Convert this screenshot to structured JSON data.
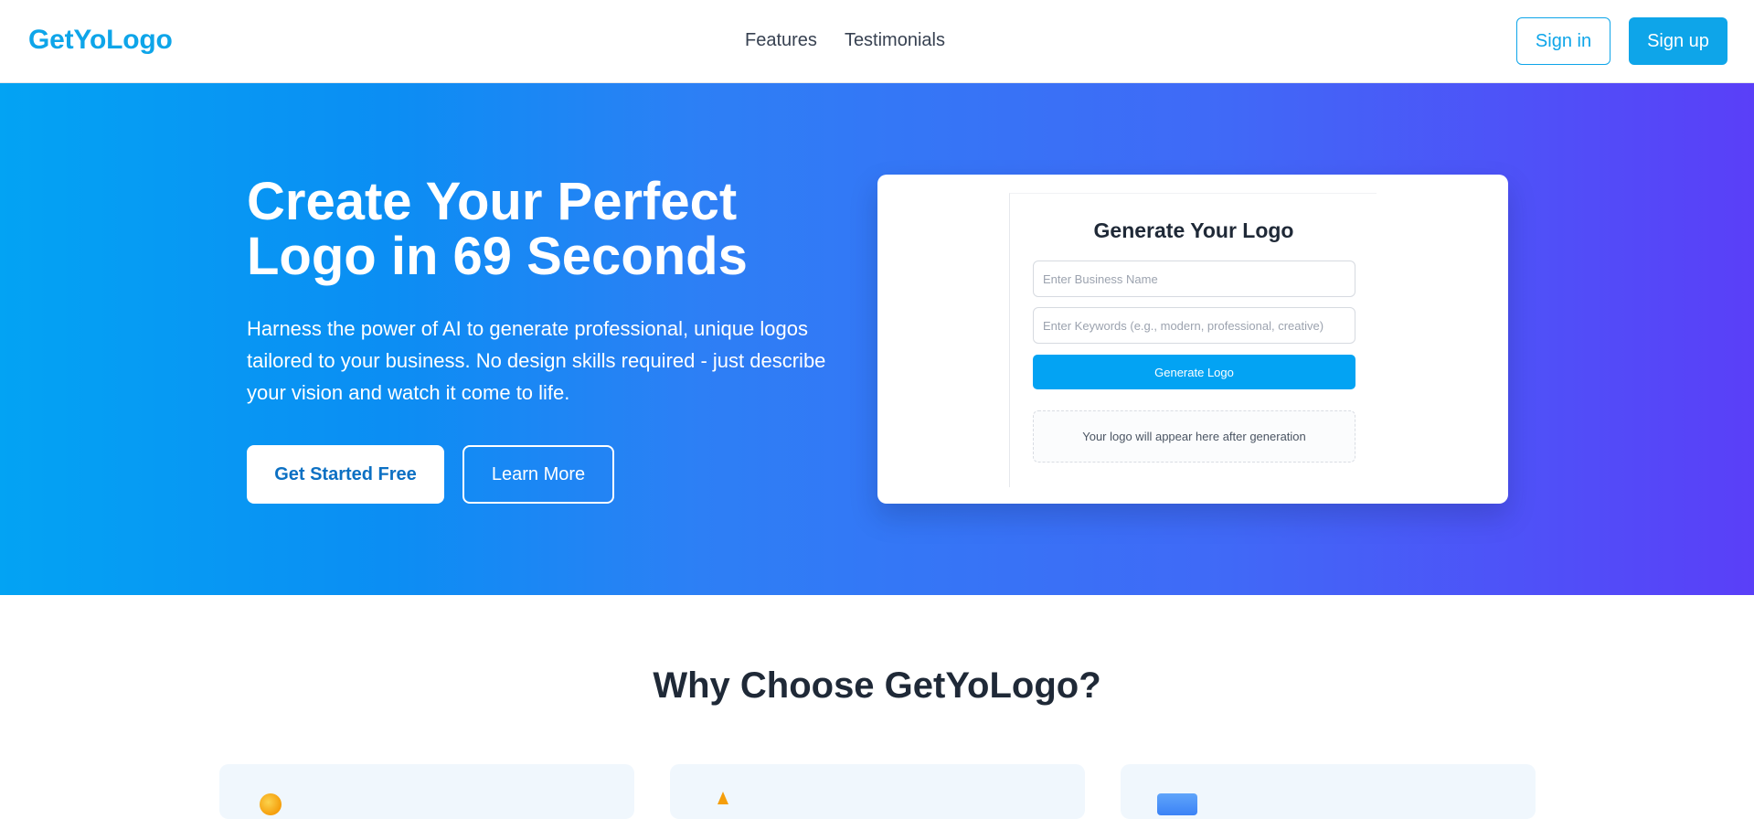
{
  "header": {
    "logo": "GetYoLogo",
    "nav": [
      "Features",
      "Testimonials"
    ],
    "signin_label": "Sign in",
    "signup_label": "Sign up"
  },
  "hero": {
    "title": "Create Your Perfect Logo in 69 Seconds",
    "subtitle": "Harness the power of AI to generate professional, unique logos tailored to your business. No design skills required - just describe your vision and watch it come to life.",
    "primary_cta": "Get Started Free",
    "secondary_cta": "Learn More"
  },
  "generator": {
    "title": "Generate Your Logo",
    "business_placeholder": "Enter Business Name",
    "keywords_placeholder": "Enter Keywords (e.g., modern, professional, creative)",
    "button_label": "Generate Logo",
    "preview_text": "Your logo will appear here after generation"
  },
  "why": {
    "title": "Why Choose GetYoLogo?",
    "cards": [
      {
        "icon": "lightbulb-icon"
      },
      {
        "icon": "lightning-icon"
      },
      {
        "icon": "palette-icon"
      }
    ]
  },
  "colors": {
    "brand": "#0ea5e9",
    "gradient_start": "#03a3f3",
    "gradient_end": "#5a3ff8"
  }
}
